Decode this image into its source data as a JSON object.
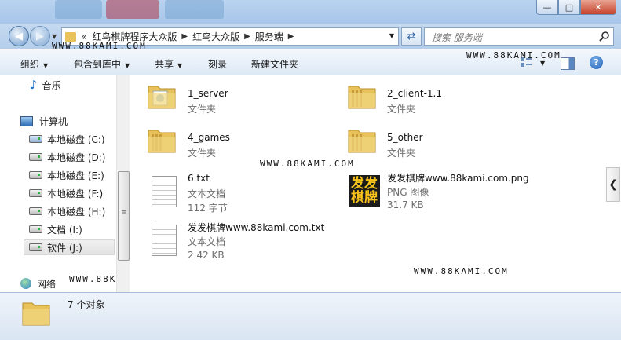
{
  "window": {
    "title_tabs": [
      "",
      "",
      ""
    ],
    "min_label": "—",
    "max_label": "□",
    "close_label": "✕"
  },
  "address": {
    "prefix": "«",
    "crumbs": [
      "红鸟棋牌程序大众版",
      "红鸟大众版",
      "服务端"
    ]
  },
  "search": {
    "placeholder": "搜索 服务端"
  },
  "toolbar": {
    "organize": "组织",
    "include": "包含到库中",
    "share": "共享",
    "burn": "刻录",
    "new_folder": "新建文件夹",
    "help": "?"
  },
  "watermark": "WWW.88KAMI.COM",
  "sidebar": {
    "items": [
      {
        "label": "音乐",
        "icon": "music-icon"
      },
      {
        "label": "计算机",
        "icon": "computer-icon"
      },
      {
        "label": "本地磁盘 (C:)",
        "icon": "system-drive-icon"
      },
      {
        "label": "本地磁盘 (D:)",
        "icon": "drive-icon"
      },
      {
        "label": "本地磁盘 (E:)",
        "icon": "drive-icon"
      },
      {
        "label": "本地磁盘 (F:)",
        "icon": "drive-icon"
      },
      {
        "label": "本地磁盘 (H:)",
        "icon": "drive-icon"
      },
      {
        "label": "文档 (I:)",
        "icon": "drive-icon"
      },
      {
        "label": "软件 (J:)",
        "icon": "drive-icon",
        "selected": true
      },
      {
        "label": "网络",
        "icon": "network-icon"
      }
    ]
  },
  "files": [
    {
      "name": "1_server",
      "type": "文件夹",
      "size": ""
    },
    {
      "name": "2_client-1.1",
      "type": "文件夹",
      "size": ""
    },
    {
      "name": "4_games",
      "type": "文件夹",
      "size": ""
    },
    {
      "name": "5_other",
      "type": "文件夹",
      "size": ""
    },
    {
      "name": "6.txt",
      "type": "文本文档",
      "size": "112 字节"
    },
    {
      "name": "发发棋牌www.88kami.com.png",
      "type": "PNG 图像",
      "size": "31.7 KB"
    },
    {
      "name": "发发棋牌www.88kami.com.txt",
      "type": "文本文档",
      "size": "2.42 KB"
    }
  ],
  "png_thumb_text": "发发\n棋牌",
  "status": {
    "count": "7 个对象"
  },
  "colors": {
    "folder": "#e8c25b",
    "accent": "#1f5fb3",
    "close": "#c7432c"
  }
}
